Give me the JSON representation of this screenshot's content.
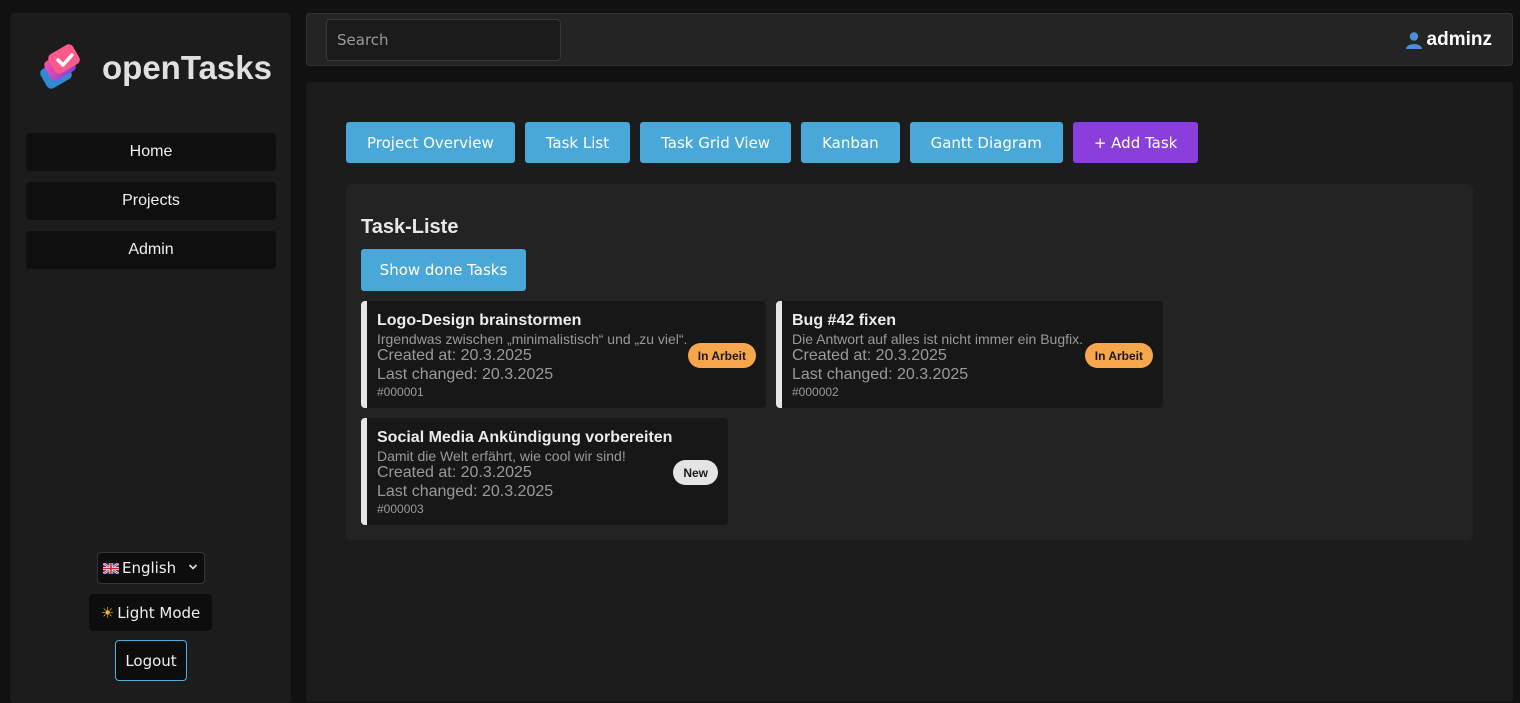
{
  "app": {
    "name": "openTasks"
  },
  "sidebar": {
    "items": [
      {
        "label": "Home"
      },
      {
        "label": "Projects"
      },
      {
        "label": "Admin"
      }
    ],
    "language": "English",
    "mode_label": "Light Mode",
    "logout_label": "Logout"
  },
  "topbar": {
    "search_placeholder": "Search",
    "username": "adminz"
  },
  "views": {
    "project_overview": "Project Overview",
    "task_list": "Task List",
    "task_grid": "Task Grid View",
    "kanban": "Kanban",
    "gantt": "Gantt Diagram",
    "add_task": "+ Add Task"
  },
  "panel": {
    "title": "Task-Liste",
    "show_done": "Show done Tasks"
  },
  "tasks": [
    {
      "title": "Logo-Design brainstormen",
      "description": "Irgendwas zwischen „minimalistisch“ und „zu viel“.",
      "created": "Created at: 20.3.2025",
      "changed": "Last changed: 20.3.2025",
      "id": "#000001",
      "status": "In Arbeit"
    },
    {
      "title": "Bug #42 fixen",
      "description": "Die Antwort auf alles ist nicht immer ein Bugfix.",
      "created": "Created at: 20.3.2025",
      "changed": "Last changed: 20.3.2025",
      "id": "#000002",
      "status": "In Arbeit"
    },
    {
      "title": "Social Media Ankündigung vorbereiten",
      "description": "Damit die Welt erfährt, wie cool wir sind!",
      "created": "Created at: 20.3.2025",
      "changed": "Last changed: 20.3.2025",
      "id": "#000003",
      "status": "New"
    }
  ],
  "colors": {
    "accent_blue": "#4aa8d8",
    "accent_purple": "#8a3fdc",
    "status_in_progress": "#f7a64c",
    "status_new": "#e4e4e4"
  }
}
